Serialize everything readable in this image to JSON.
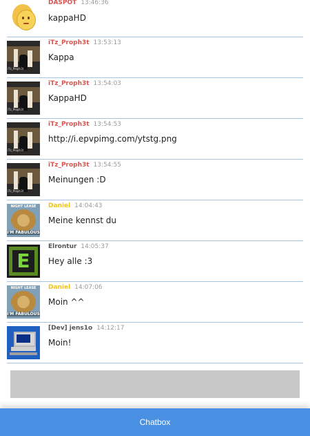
{
  "messages": [
    {
      "user": "DASPOT",
      "user_color": "#d9534f",
      "time": "13:46:36",
      "text": "kappaHD",
      "avatar": "smiley-avatar"
    },
    {
      "user": "iTz_Proph3t",
      "user_color": "#d9534f",
      "time": "13:53:13",
      "text": "Kappa",
      "avatar": "proph-avatar"
    },
    {
      "user": "iTz_Proph3t",
      "user_color": "#d9534f",
      "time": "13:54:03",
      "text": "KappaHD",
      "avatar": "proph-avatar"
    },
    {
      "user": "iTz_Proph3t",
      "user_color": "#d9534f",
      "time": "13:54:53",
      "text": "http://i.epvpimg.com/ytstg.png",
      "avatar": "proph-avatar"
    },
    {
      "user": "iTz_Proph3t",
      "user_color": "#d9534f",
      "time": "13:54:55",
      "text": "Meinungen :D",
      "avatar": "proph-avatar"
    },
    {
      "user": "Daniel",
      "user_color": "#f0c419",
      "time": "14:04:43",
      "text": "Meine kennst du",
      "avatar": "lion-avatar"
    },
    {
      "user": "Elrontur",
      "user_color": "#555555",
      "time": "14:05:37",
      "text": "Hey alle :3",
      "avatar": "e-avatar"
    },
    {
      "user": "Daniel",
      "user_color": "#f0c419",
      "time": "14:07:06",
      "text": "Moin ^^",
      "avatar": "lion-avatar"
    },
    {
      "user": "[Dev] jens1o",
      "user_color": "#555555",
      "time": "14:12:17",
      "text": "Moin!",
      "avatar": "pc-avatar"
    }
  ],
  "lion_avatar_top_text": "NIGHT LEASE",
  "lion_avatar_bottom_text": "I'M FABULOUS",
  "proph_avatar_caption": "iTz_Proph3t",
  "chatbox_label": "Chatbox",
  "accent_color": "#4a90e2",
  "divider_color": "#a9c4de"
}
